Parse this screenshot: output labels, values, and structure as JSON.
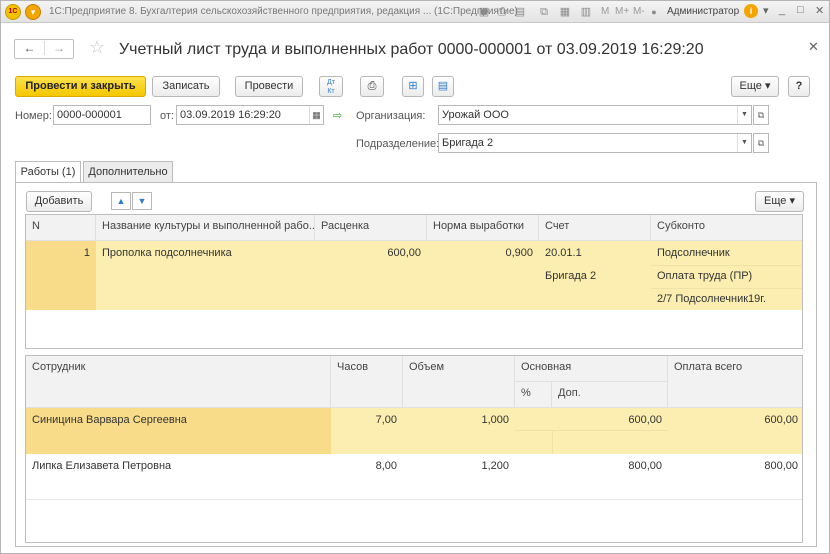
{
  "window": {
    "title": "1С:Предприятие 8. Бухгалтерия сельскохозяйственного предприятия, редакция ... (1С:Предприятие)",
    "user": "Администратор",
    "toolbar_text": {
      "m": "M",
      "mplus": "M+",
      "mminus": "M-"
    },
    "logo": "1С"
  },
  "document": {
    "title": "Учетный лист труда и выполненных работ 0000-000001 от 03.09.2019 16:29:20"
  },
  "toolbar": {
    "post_close": "Провести и закрыть",
    "save": "Записать",
    "post": "Провести",
    "more": "Еще",
    "help": "?"
  },
  "form": {
    "number_label": "Номер:",
    "number_value": "0000-000001",
    "date_label": "от:",
    "date_value": "03.09.2019 16:29:20",
    "org_label": "Организация:",
    "org_value": "Урожай ООО",
    "dept_label": "Подразделение:",
    "dept_value": "Бригада 2"
  },
  "tabs": [
    "Работы (1)",
    "Дополнительно"
  ],
  "works_toolbar": {
    "add": "Добавить",
    "more": "Еще"
  },
  "works_table": {
    "columns": [
      "N",
      "Название культуры и выполненной рабо...",
      "Расценка",
      "Норма выработки",
      "Счет",
      "Субконто"
    ],
    "rows": [
      {
        "n": "1",
        "name": "Прополка подсолнечника",
        "rate": "600,00",
        "norm": "0,900",
        "accounts": [
          "20.01.1",
          "Бригада 2"
        ],
        "subconto": [
          "Подсолнечник",
          "Оплата труда (ПР)",
          "2/7 Подсолнечник19г."
        ]
      }
    ]
  },
  "staff_table": {
    "columns": {
      "employee": "Сотрудник",
      "hours": "Часов",
      "volume": "Объем",
      "main": "Основная",
      "pct": "%",
      "add": "Доп.",
      "total": "Оплата всего"
    },
    "rows": [
      {
        "employee": "Синицина Варвара Сергеевна",
        "hours": "7,00",
        "volume": "1,000",
        "main": "600,00",
        "total": "600,00"
      },
      {
        "employee": "Липка Елизавета Петровна",
        "hours": "8,00",
        "volume": "1,200",
        "main": "800,00",
        "total": "800,00"
      }
    ]
  },
  "colors": {
    "accent": "#f4c700",
    "selected_row": "#fbeeb0",
    "selected_cell": "#f8dc8a"
  }
}
